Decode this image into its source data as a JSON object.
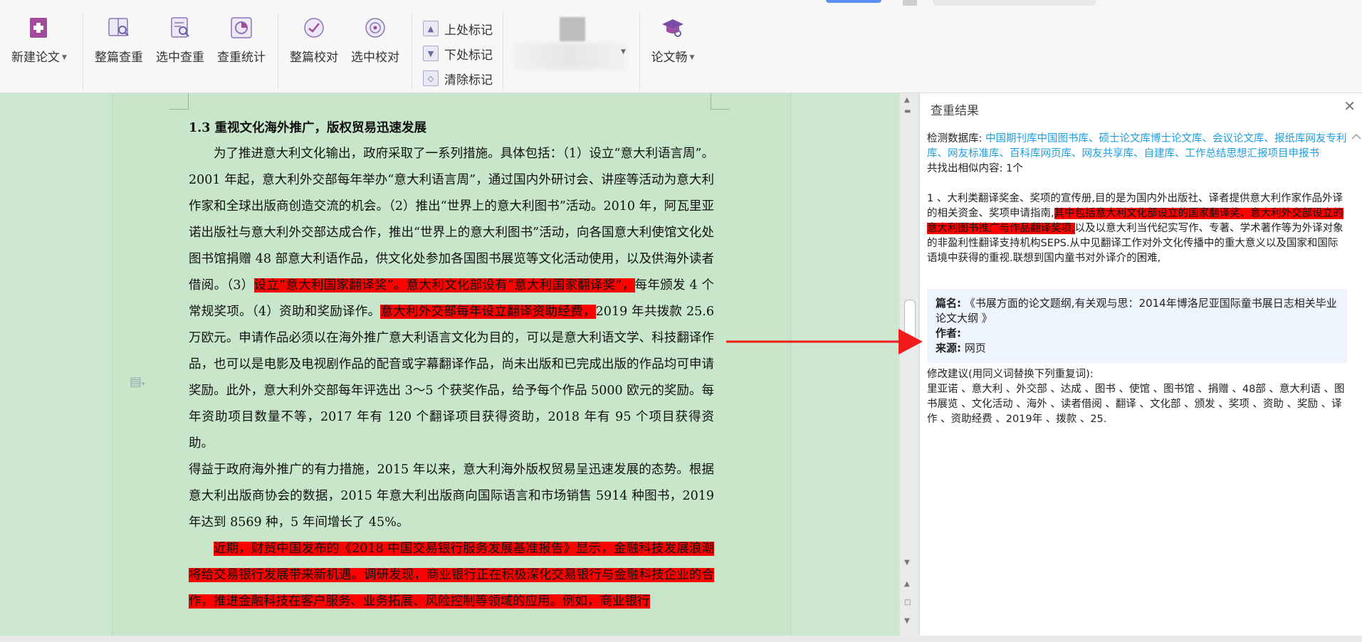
{
  "toolbar": {
    "new_paper": "新建论文",
    "full_check": "整篇查重",
    "select_check": "选中查重",
    "check_stats": "查重统计",
    "full_proof": "整篇校对",
    "select_proof": "选中校对",
    "prev_mark": "上处标记",
    "next_mark": "下处标记",
    "clear_mark": "清除标记",
    "lunwenchang": "论文畅"
  },
  "document": {
    "heading": "1.3  重视文化海外推广，版权贸易迅速发展",
    "p1_a": "为了推进意大利文化输出，政府采取了一系列措施。具体包括：（1）设立“意大利语言周”。2001 年起，意大利外交部每年举办“意大利语言周”，通过国内外研讨会、讲座等活动为意大利作家和全球出版商创造交流的机会。（2）推出“世界上的意大利图书”活动。2010 年，阿瓦里亚诺出版社与意大利外交部达成合作，推出“世界上的意大利图书”活动，向各国意大利使馆文化处图书馆捐赠 48 部意大利语作品，供文化处参加各国图书展览等文化活动使用，以及供海外读者借阅。（3）",
    "p1_hl1": "设立“意大利国家翻译奖”。意大利文化部设有“意大利国家翻译奖”，",
    "p1_b": "每年颁发 4 个常规奖项。（4）资助和奖励译作。",
    "p1_hl2": "意大利外交部每年设立翻译资助经费，",
    "p1_c": "2019 年共拨款 25.6 万欧元。申请作品必须以在海外推广意大利语言文化为目的，可以是意大利语文学、科技翻译作品，也可以是电影及电视剧作品的配音或字幕翻译作品，尚未出版和已完成出版的作品均可申请奖励。此外，意大利外交部每年评选出 3～5 个获奖作品，给予每个作品 5000 欧元的奖励。每年资助项目数量不等，2017 年有 120 个翻译项目获得资助，2018 年有 95 个项目获得资助。",
    "p2": "得益于政府海外推广的有力措施，2015 年以来，意大利海外版权贸易呈迅速发展的态势。根据意大利出版商协会的数据，2015 年意大利出版商向国际语言和市场销售 5914 种图书，2019 年达到 8569 种，5 年间增长了 45%。",
    "p3_hl": "近期，财贸中国发布的《2018 中国交易银行服务发展基准报告》显示，金融科技发展浪潮将给交易银行发展带来新机遇。调研发现，商业银行正在积极深化交易银行与金融科技企业的合作，推进金融科技在客户服务、业务拓展、风险控制等领域的应用。例如，商业银行"
  },
  "panel": {
    "title": "查重结果",
    "db_label": "检测数据库:",
    "db_list": "中国期刊库中国图书库、硕士论文库博士论文库、会议论文库、报纸库网友专利库、网友标准库、百科库网页库、网友共享库、自建库、工作总结思想汇报项目申报书",
    "found_label": "共找出相似内容:",
    "found_count": "1个",
    "match_a": "1 、大利类翻译奖金、奖项的宣传册,目的是为国内外出版社、译者提供意大利作家作品外译的相关资金、奖项申请指南,",
    "match_hl": "其中包括意大利文化部设立的国家翻译奖、意大利外交部设立的意大利图书推广与作品翻译奖项,",
    "match_b": "以及以意大利当代纪实写作、专著、学术著作等为外译对象的非盈利性翻译支持机构SEPS.从中见翻译工作对外文化传播中的重大意义以及国家和国际语境中获得的重视.联想到国内童书对外译介的困难,",
    "source_title_label": "篇名:",
    "source_title": "《书展方面的论文题纲,有关观与思：2014年博洛尼亚国际童书展日志相关毕业论文大纲 》",
    "author_label": "作者:",
    "author": "",
    "origin_label": "来源:",
    "origin": "网页",
    "suggest_label": "修改建议(用同义词替换下列重复词):",
    "suggest_words": "里亚诺 、意大利 、外交部 、达成 、图书 、使馆 、图书馆 、捐赠 、48部 、意大利语 、图书展览 、文化活动 、海外 、读者借阅 、翻译 、文化部 、颁发 、奖项 、资助 、奖励 、译作 、资助经费 、2019年 、拨款 、25."
  }
}
